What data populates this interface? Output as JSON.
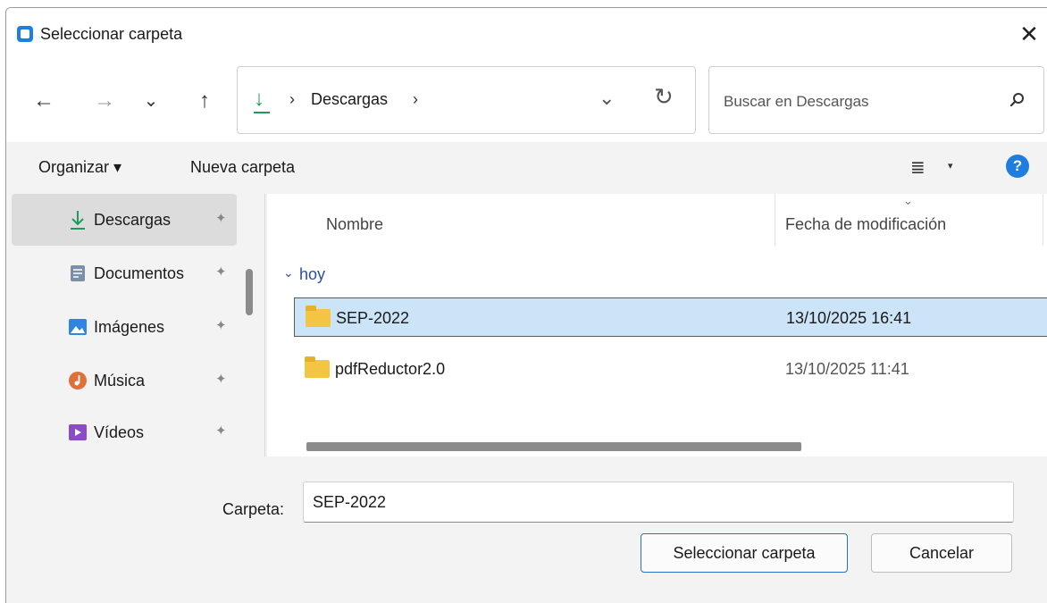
{
  "window": {
    "title": "Seleccionar carpeta",
    "close_glyph": "✕"
  },
  "nav": {
    "back_glyph": "←",
    "forward_glyph": "→",
    "recent_glyph": "⌄",
    "up_glyph": "↑"
  },
  "address": {
    "icon": "download-icon",
    "separator": "›",
    "crumb": "Descargas",
    "dropdown_glyph": "⌄",
    "refresh_glyph": "↻"
  },
  "search": {
    "placeholder": "Buscar en Descargas",
    "icon": "search-icon"
  },
  "toolbar": {
    "organize_label": "Organizar ▾",
    "new_folder_label": "Nueva carpeta",
    "view_glyph": "≣",
    "view_caret": "▾",
    "help_glyph": "?"
  },
  "sidebar": {
    "items": [
      {
        "label": "Descargas",
        "icon": "download-icon",
        "selected": true
      },
      {
        "label": "Documentos",
        "icon": "document-icon"
      },
      {
        "label": "Imágenes",
        "icon": "pictures-icon"
      },
      {
        "label": "Música",
        "icon": "music-icon"
      },
      {
        "label": "Vídeos",
        "icon": "videos-icon"
      }
    ],
    "pin_glyph": "📌"
  },
  "filelist": {
    "columns": [
      "Nombre",
      "Fecha de modificación"
    ],
    "sort_caret": "⌄",
    "group": {
      "caret": "⌄",
      "label": "hoy"
    },
    "rows": [
      {
        "name": "SEP-2022",
        "date": "13/10/2025 16:41",
        "selected": true
      },
      {
        "name": "pdfReductor2.0",
        "date": "13/10/2025 11:41"
      }
    ]
  },
  "footer": {
    "folder_label": "Carpeta:",
    "folder_value": "SEP-2022",
    "select_button": "Seleccionar carpeta",
    "cancel_button": "Cancelar"
  },
  "colors": {
    "accent": "#1f7de0",
    "selection": "#cce4f7",
    "download_green": "#1f9a5a",
    "folder_yellow": "#f4c542"
  }
}
